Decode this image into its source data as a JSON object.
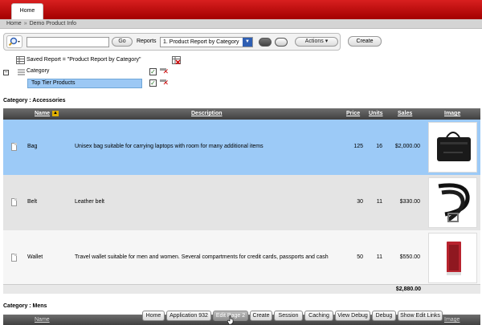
{
  "header": {
    "tab_home": "Home"
  },
  "breadcrumb": {
    "items": [
      "Home",
      "Demo Product Info"
    ],
    "separator": "»"
  },
  "toolbar": {
    "search_value": "",
    "go_label": "Go",
    "reports_label": "Reports",
    "reports_selected": "1. Product Report by Category",
    "actions_label": "Actions",
    "create_label": "Create"
  },
  "filters": {
    "saved_report": "Saved Report = \"Product Report by Category\"",
    "category": "Category",
    "top_tier": "Top Tier Products"
  },
  "report": {
    "category_heading": "Category : Accessories",
    "columns": {
      "name": "Name",
      "description": "Description",
      "price": "Price",
      "units": "Units",
      "sales": "Sales",
      "image": "Image"
    },
    "rows": [
      {
        "name": "Bag",
        "description": "Unisex bag suitable for carrying laptops with room for many additional items",
        "price": "125",
        "units": "16",
        "sales": "$2,000.00",
        "image_icon": "bag-image"
      },
      {
        "name": "Belt",
        "description": "Leather belt",
        "price": "30",
        "units": "11",
        "sales": "$330.00",
        "image_icon": "belt-image"
      },
      {
        "name": "Wallet",
        "description": "Travel wallet suitable for men and women. Several compartments for credit cards, passports and cash",
        "price": "50",
        "units": "11",
        "sales": "$550.00",
        "image_icon": "wallet-image"
      }
    ],
    "total": "$2,880.00",
    "category_heading_2": "Category : Mens",
    "columns_2": {
      "name": "Name",
      "image": "Image"
    }
  },
  "dev_toolbar": {
    "buttons": [
      "Home",
      "Application 932",
      "Edit Page 2",
      "Create",
      "Session",
      "Caching",
      "View Debug",
      "Debug",
      "Show Edit Links"
    ],
    "active_index": 2
  },
  "colors": {
    "header_red": "#c40f0f",
    "selected_row": "#9ccaf7",
    "table_header": "#4a4a4a"
  }
}
